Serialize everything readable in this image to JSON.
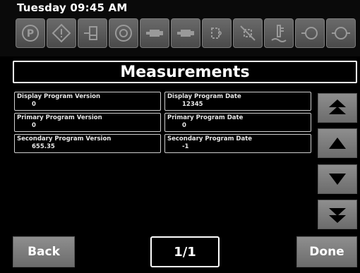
{
  "header": {
    "datetime": "Tuesday 09:45 AM",
    "indicators": [
      {
        "name": "parking-brake-icon"
      },
      {
        "name": "warning-diamond-icon"
      },
      {
        "name": "coolant-level-icon"
      },
      {
        "name": "engine-oil-icon"
      },
      {
        "name": "engine-icon"
      },
      {
        "name": "engine-stop-icon"
      },
      {
        "name": "glow-plug-icon"
      },
      {
        "name": "water-in-fuel-icon"
      },
      {
        "name": "coolant-temperature-icon"
      },
      {
        "name": "transmission-icon"
      },
      {
        "name": "air-filter-icon"
      }
    ]
  },
  "title": "Measurements",
  "fields": {
    "display_version": {
      "label": "Display Program Version",
      "value": "0"
    },
    "display_date": {
      "label": "Display Program Date",
      "value": "12345"
    },
    "primary_version": {
      "label": "Primary Program Version",
      "value": "0"
    },
    "primary_date": {
      "label": "Primary Program Date",
      "value": "0"
    },
    "secondary_version": {
      "label": "Secondary Program Version",
      "value": "655.35"
    },
    "secondary_date": {
      "label": "Secondary Program Date",
      "value": "-1"
    }
  },
  "scroll": {
    "page_up": "double-up-arrow-icon",
    "line_up": "up-arrow-icon",
    "line_down": "down-arrow-icon",
    "page_down": "double-down-arrow-icon"
  },
  "footer": {
    "back_label": "Back",
    "page_indicator": "1/1",
    "done_label": "Done"
  },
  "colors": {
    "background": "#000000",
    "button_gray": "#7d7d7d",
    "indicator_gray": "#5a5a5a",
    "text": "#ffffff"
  }
}
